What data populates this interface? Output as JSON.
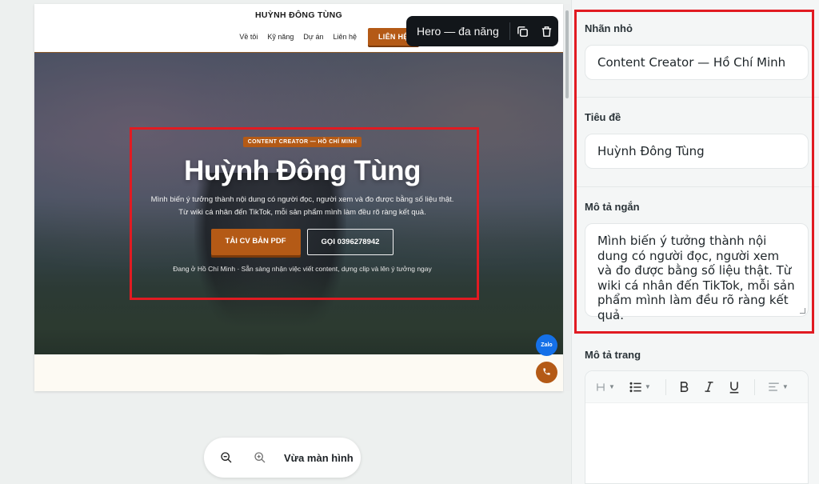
{
  "site": {
    "name": "HUỲNH ĐÔNG TÙNG",
    "nav": [
      "Về tôi",
      "Kỹ năng",
      "Dự án",
      "Liên hệ"
    ],
    "nav_cta": "LIÊN HỆ"
  },
  "hero": {
    "badge": "CONTENT CREATOR — HỒ CHÍ MINH",
    "title": "Huỳnh Đông Tùng",
    "desc_line1": "Mình biến ý tưởng thành nội dung có người đọc, người xem và đo được bằng số liệu thật.",
    "desc_line2": "Từ wiki cá nhân đến TikTok, mỗi sản phẩm mình làm đều rõ ràng kết quả.",
    "btn_primary": "TẢI CV BẢN PDF",
    "btn_secondary": "GỌI 0396278942",
    "note": "Đang ở Hồ Chí Minh · Sẵn sàng nhận việc viết content, dựng clip và lên ý tưởng ngay"
  },
  "floating": {
    "zalo": "Zalo"
  },
  "block_toolbar": {
    "label": "Hero — đa năng",
    "icons": [
      "copy-icon",
      "trash-icon"
    ]
  },
  "zoom": {
    "fit_label": "Vừa màn hình",
    "icons": [
      "zoom-out-icon",
      "zoom-in-icon"
    ]
  },
  "panel": {
    "small_label": {
      "label": "Nhãn nhỏ",
      "value": "Content Creator — Hồ Chí Minh"
    },
    "title": {
      "label": "Tiêu đề",
      "value": "Huỳnh Đông Tùng"
    },
    "short_desc": {
      "label": "Mô tả ngắn",
      "value": "Mình biến ý tưởng thành nội dung có người đọc, người xem và đo được bằng số liệu thật. Từ wiki cá nhân đến TikTok, mỗi sản phẩm mình làm đều rõ ràng kết quả."
    },
    "page_desc": {
      "label": "Mô tả trang"
    },
    "editor_tools": [
      "heading-icon",
      "list-icon",
      "bold-icon",
      "italic-icon",
      "underline-icon",
      "align-icon"
    ]
  },
  "colors": {
    "accent": "#b45a16",
    "selection": "#e11b22",
    "zalo": "#1570e8"
  }
}
